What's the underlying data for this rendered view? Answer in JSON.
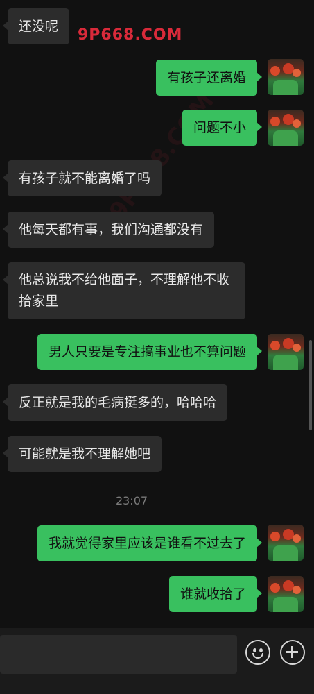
{
  "watermark": "9P668.COM",
  "watermark_diagonal": "9P668.COM",
  "messages": [
    {
      "side": "left",
      "text": "还没呢"
    },
    {
      "side": "right",
      "text": "有孩子还离婚"
    },
    {
      "side": "right",
      "text": "问题不小"
    },
    {
      "side": "left",
      "text": "有孩子就不能离婚了吗"
    },
    {
      "side": "left",
      "text": "他每天都有事，我们沟通都没有"
    },
    {
      "side": "left",
      "text": "他总说我不给他面子，不理解他不收拾家里"
    },
    {
      "side": "right",
      "text": "男人只要是专注搞事业也不算问题"
    },
    {
      "side": "left",
      "text": "反正就是我的毛病挺多的，哈哈哈"
    },
    {
      "side": "left",
      "text": "可能就是我不理解她吧"
    },
    {
      "side": "right",
      "text": "我就觉得家里应该是谁看不过去了"
    },
    {
      "side": "right",
      "text": "谁就收拾了"
    }
  ],
  "timestamp": "23:07",
  "colors": {
    "background": "#111111",
    "incoming_bubble": "#2c2c2c",
    "outgoing_bubble": "#39c05f"
  },
  "icons": {
    "emoji": "smiley-face-icon",
    "more": "plus-circle-icon"
  }
}
